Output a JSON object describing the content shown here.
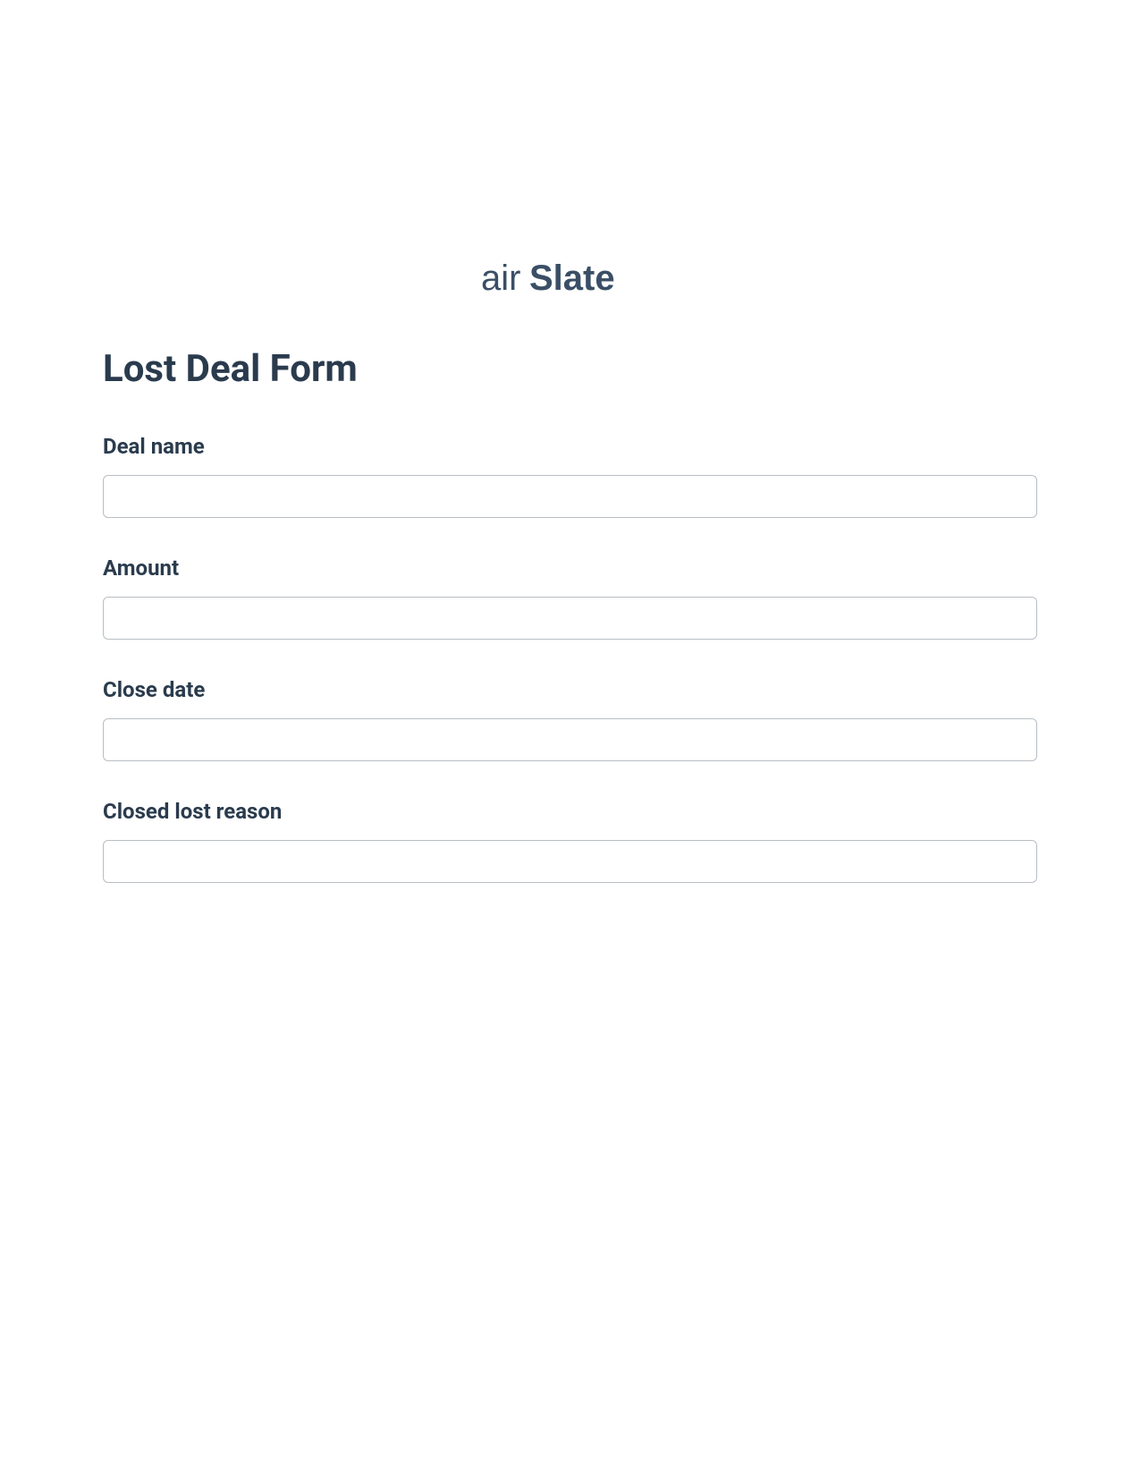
{
  "logo": {
    "text": "airSlate",
    "color": "#3a4f66"
  },
  "form": {
    "title": "Lost Deal Form",
    "fields": [
      {
        "label": "Deal name",
        "value": ""
      },
      {
        "label": "Amount",
        "value": ""
      },
      {
        "label": "Close date",
        "value": ""
      },
      {
        "label": "Closed lost reason",
        "value": ""
      }
    ]
  }
}
